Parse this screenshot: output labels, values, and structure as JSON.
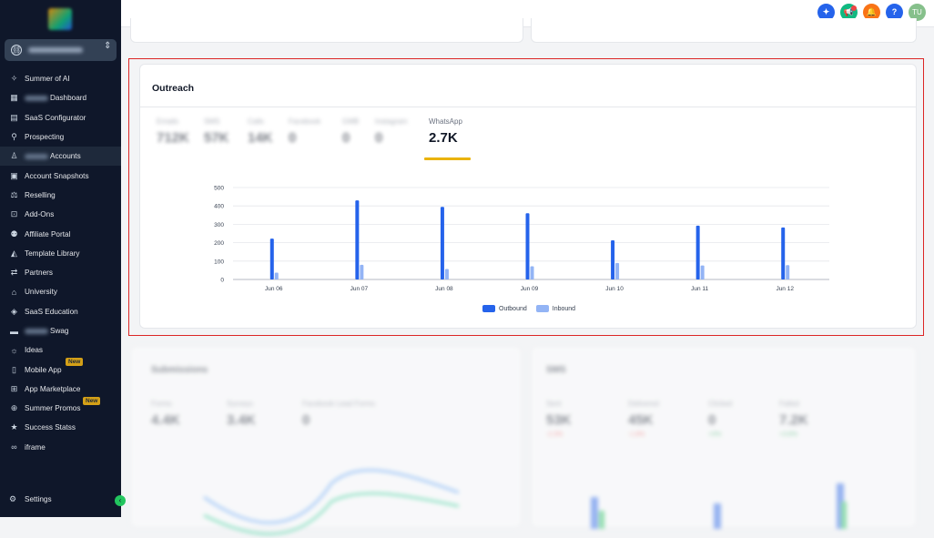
{
  "sidebar": {
    "items": [
      {
        "label": "Summer of AI",
        "icon": "sparkle-icon"
      },
      {
        "label": "Dashboard",
        "icon": "dashboard-icon",
        "blurred_prefix": true
      },
      {
        "label": "SaaS Configurator",
        "icon": "bar-chart-icon"
      },
      {
        "label": "Prospecting",
        "icon": "user-search-icon"
      },
      {
        "label": "Accounts",
        "icon": "user-icon",
        "blurred_prefix": true,
        "active": true
      },
      {
        "label": "Account Snapshots",
        "icon": "snapshot-icon"
      },
      {
        "label": "Reselling",
        "icon": "reselling-icon"
      },
      {
        "label": "Add-Ons",
        "icon": "bag-icon"
      },
      {
        "label": "Affiliate Portal",
        "icon": "users-icon"
      },
      {
        "label": "Template Library",
        "icon": "shapes-icon"
      },
      {
        "label": "Partners",
        "icon": "handshake-icon"
      },
      {
        "label": "University",
        "icon": "graduation-cap-icon"
      },
      {
        "label": "SaaS Education",
        "icon": "cube-icon"
      },
      {
        "label": "Swag",
        "icon": "store-icon",
        "blurred_prefix": true
      },
      {
        "label": "Ideas",
        "icon": "bulb-icon"
      },
      {
        "label": "Mobile App",
        "icon": "mobile-icon",
        "badge": "New"
      },
      {
        "label": "App Marketplace",
        "icon": "grid-icon"
      },
      {
        "label": "Summer Promos",
        "icon": "gift-icon",
        "badge": "New"
      },
      {
        "label": "Success Statss",
        "icon": "star-icon"
      },
      {
        "label": "iframe",
        "icon": "glasses-icon"
      }
    ],
    "settings_label": "Settings",
    "collapse_symbol": "‹"
  },
  "topbar": {
    "help_symbol": "?",
    "avatar_initials": "TU"
  },
  "outreach": {
    "title": "Outreach",
    "active_stat": {
      "label": "WhatsApp",
      "value": "2.7K"
    },
    "blurred_stats": [
      {
        "label": "Emails",
        "value": "712K"
      },
      {
        "label": "SMS",
        "value": "57K"
      },
      {
        "label": "Calls",
        "value": "14K"
      },
      {
        "label": "Facebook",
        "value": "0"
      },
      {
        "label": "GMB",
        "value": "0"
      },
      {
        "label": "Instagram",
        "value": "0"
      }
    ]
  },
  "chart_data": {
    "type": "bar",
    "categories": [
      "Jun 06",
      "Jun 07",
      "Jun 08",
      "Jun 09",
      "Jun 10",
      "Jun 11",
      "Jun 12"
    ],
    "series": [
      {
        "name": "Outbound",
        "color": "#2563eb",
        "values": [
          222,
          430,
          395,
          360,
          213,
          293,
          283
        ]
      },
      {
        "name": "Inbound",
        "color": "#93b4f5",
        "values": [
          37,
          80,
          57,
          72,
          90,
          76,
          78
        ]
      }
    ],
    "yticks": [
      0,
      100,
      200,
      300,
      400,
      500
    ],
    "ylim": [
      0,
      500
    ],
    "grid": true,
    "legend": "bottom-center"
  },
  "lower_left": {
    "title": "Submissions",
    "stats": [
      {
        "label": "Forms",
        "value": "4.4K"
      },
      {
        "label": "Surveys",
        "value": "3.4K"
      },
      {
        "label": "Facebook Lead Forms",
        "value": "0"
      }
    ]
  },
  "lower_right": {
    "title": "SMS",
    "stats": [
      {
        "label": "Sent",
        "value": "53K",
        "delta": "-2.3%"
      },
      {
        "label": "Delivered",
        "value": "45K",
        "delta": "-1.8%"
      },
      {
        "label": "Clicked",
        "value": "0",
        "delta": "+0%"
      },
      {
        "label": "Failed",
        "value": "7.2K",
        "delta": "+3.8%"
      }
    ]
  }
}
